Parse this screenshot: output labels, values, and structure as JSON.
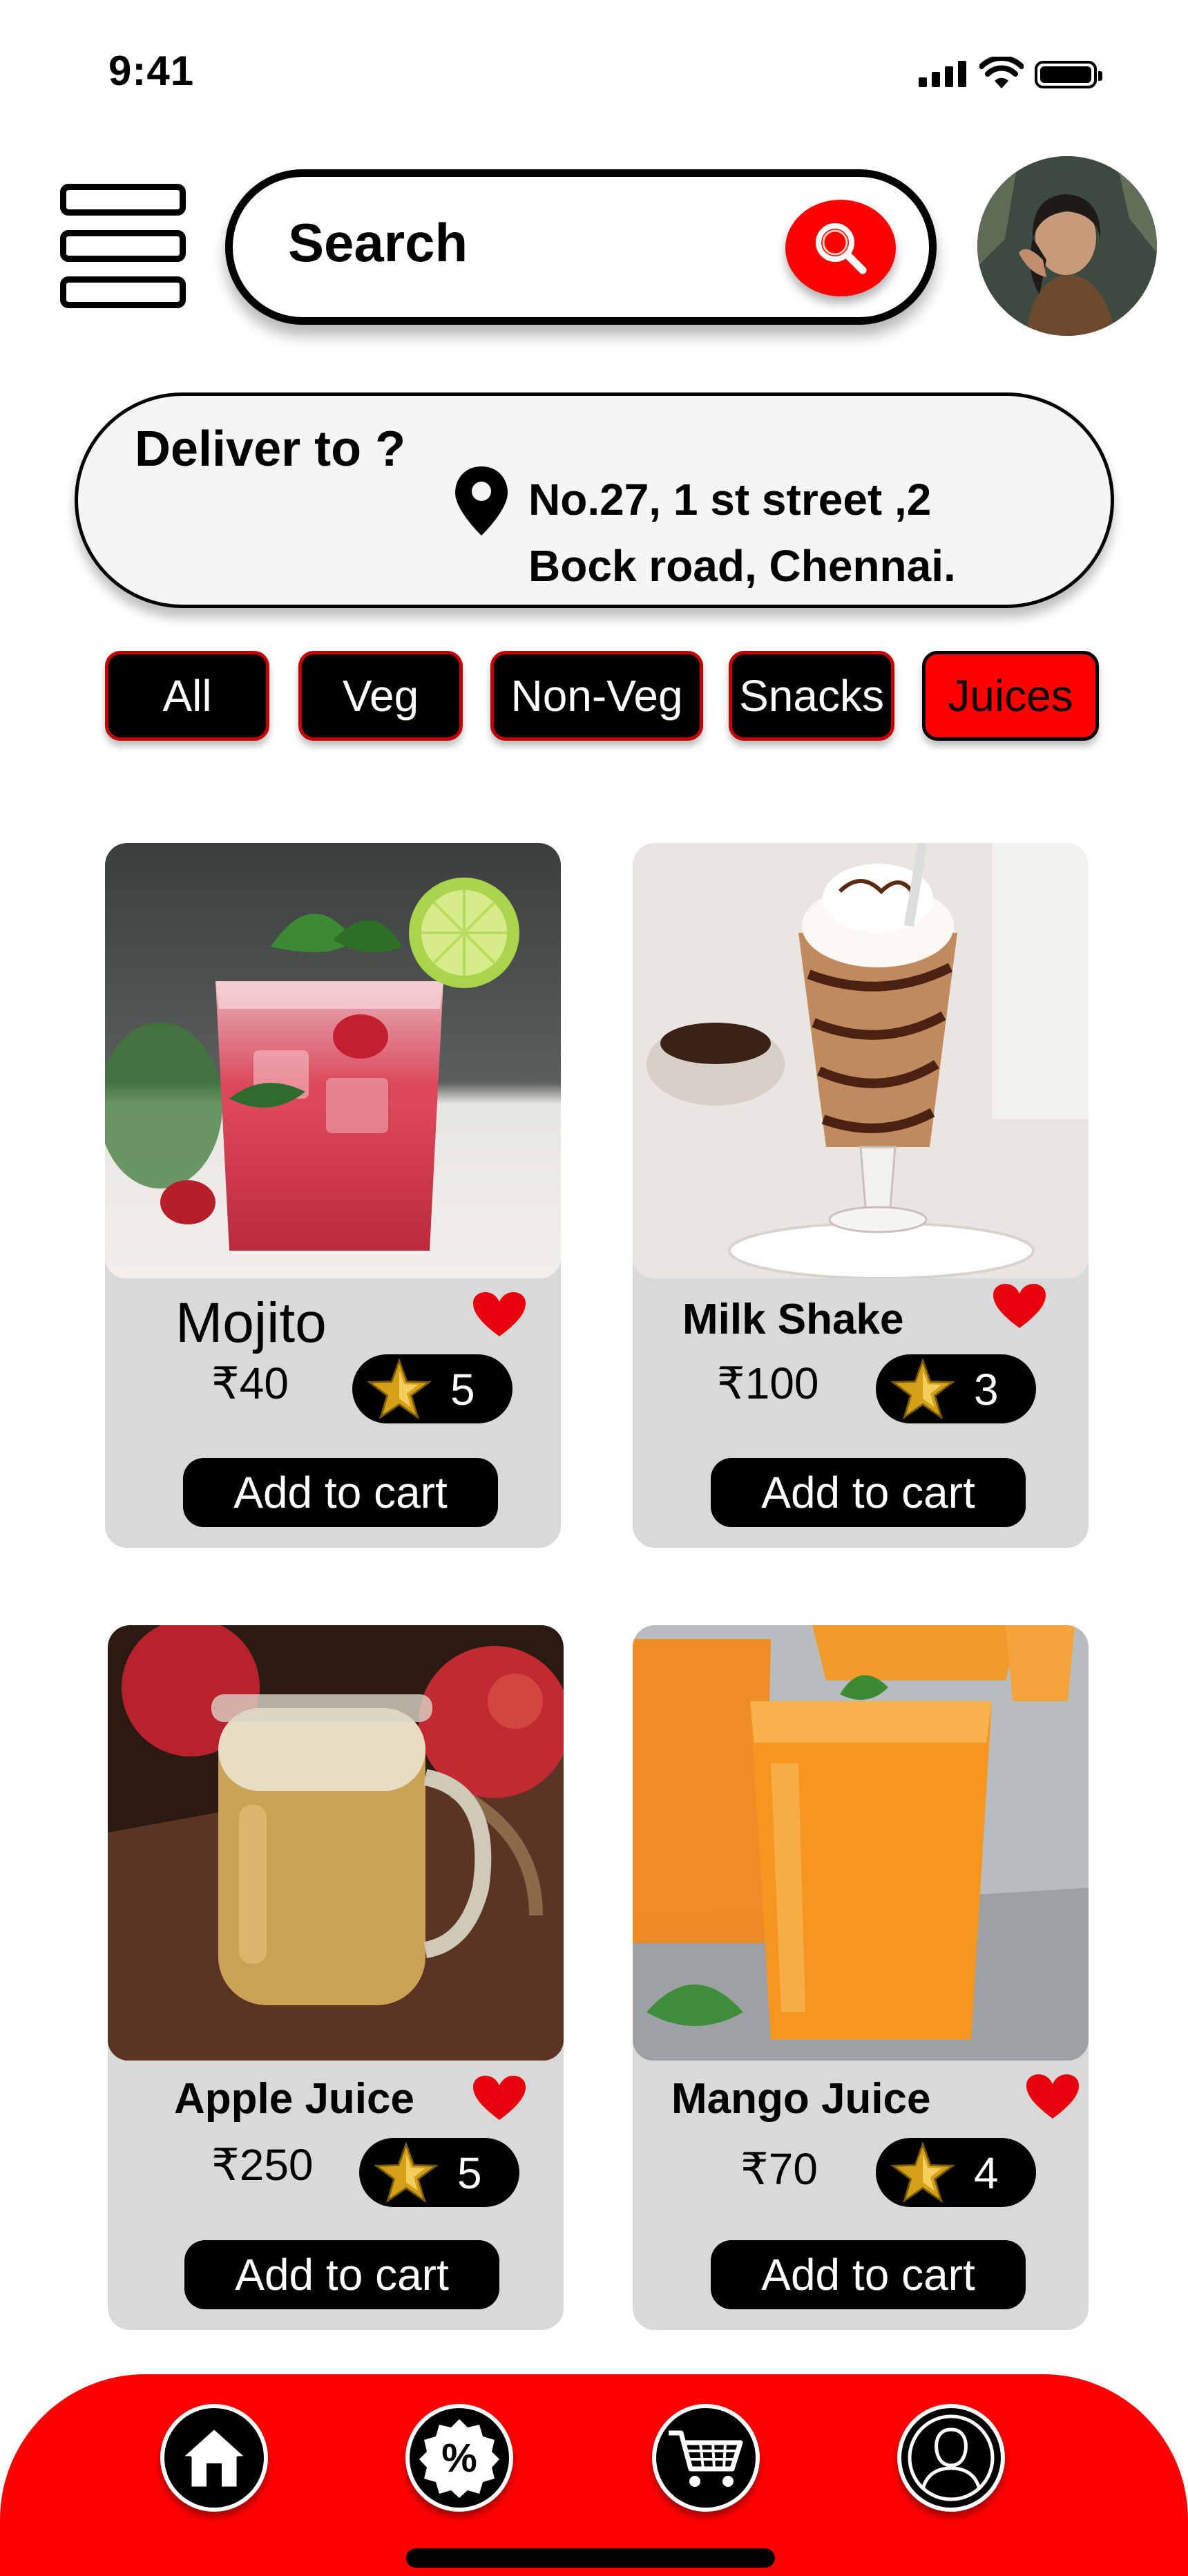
{
  "status_bar": {
    "time": "9:41",
    "icons": [
      "signal-icon",
      "wifi-icon",
      "battery-icon"
    ]
  },
  "header": {
    "menu_icon": "hamburger-menu-icon",
    "search": {
      "label": "Search",
      "icon": "search-icon"
    },
    "avatar": "user-avatar"
  },
  "deliver": {
    "title": "Deliver to ?",
    "pin_icon": "location-pin-icon",
    "address_line1": "No.27, 1 st street ,2",
    "address_line2": "Bock road, Chennai."
  },
  "categories": [
    {
      "label": "All",
      "active": false
    },
    {
      "label": "Veg",
      "active": false
    },
    {
      "label": "Non-Veg",
      "active": false
    },
    {
      "label": "Snacks",
      "active": false
    },
    {
      "label": "Juices",
      "active": true
    }
  ],
  "products": [
    {
      "name": "Mojito",
      "price": "₹40",
      "rating": "5",
      "button": "Add to cart",
      "favorite": true
    },
    {
      "name": "Milk Shake",
      "price": "₹100",
      "rating": "3",
      "button": "Add to cart",
      "favorite": true
    },
    {
      "name": "Apple Juice",
      "price": "₹250",
      "rating": "5",
      "button": "Add to cart",
      "favorite": true
    },
    {
      "name": "Mango Juice",
      "price": "₹70",
      "rating": "4",
      "button": "Add to cart",
      "favorite": true
    }
  ],
  "bottom_nav": {
    "items": [
      "home-icon",
      "offers-percent-icon",
      "cart-icon",
      "profile-icon"
    ]
  },
  "colors": {
    "accent": "#ff0000",
    "dark": "#000000",
    "card_bg": "#d9d9d9",
    "star": "#d4a017"
  }
}
